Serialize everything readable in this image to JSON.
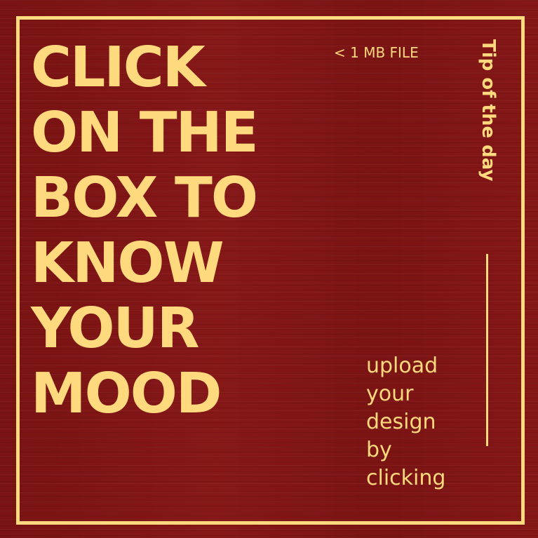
{
  "headline": {
    "lines": [
      "CLICK",
      "ON THE",
      "BOX TO",
      "KNOW",
      "YOUR",
      "MOOD"
    ]
  },
  "file_size_note": "< 1 MB FILE",
  "tip_label": "Tip of the day",
  "upload_text": {
    "lines": [
      "upload",
      "your",
      "design",
      "by",
      "clicking"
    ]
  },
  "colors": {
    "background": "#7e1414",
    "accent": "#ffd97d"
  }
}
